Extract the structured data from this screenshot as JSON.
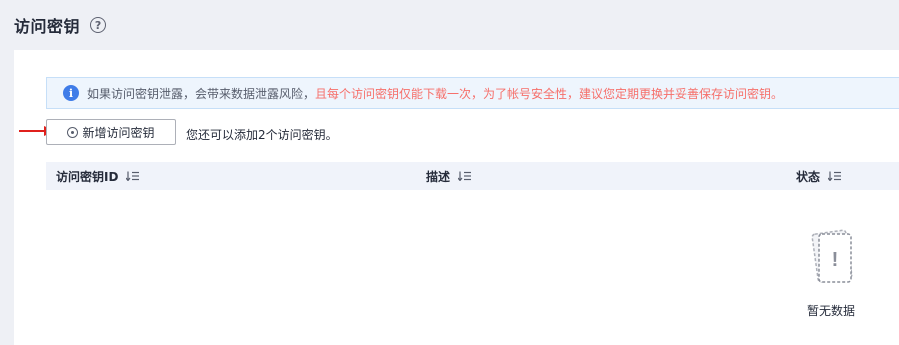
{
  "header": {
    "title": "访问密钥",
    "help_icon": "question-circle-icon"
  },
  "notice": {
    "icon": "info-icon",
    "normal_text": "如果访问密钥泄露，会带来数据泄露风险，",
    "warning_text": "且每个访问密钥仅能下载一次，为了帐号安全性，建议您定期更换并妥善保存访问密钥。",
    "warning_color": "#f66f6a"
  },
  "toolbar": {
    "add_button_label": "新增访问密钥",
    "add_icon": "plus-circle-icon",
    "quota_hint": "您还可以添加2个访问密钥。"
  },
  "table": {
    "columns": [
      {
        "label": "访问密钥ID",
        "sort_icon": "sort-icon"
      },
      {
        "label": "描述",
        "sort_icon": "sort-icon"
      },
      {
        "label": "状态",
        "sort_icon": "sort-icon"
      }
    ],
    "rows": [],
    "empty_text": "暂无数据",
    "empty_icon": "empty-card-icon"
  },
  "annotation": {
    "arrow_color": "#e0201c"
  }
}
